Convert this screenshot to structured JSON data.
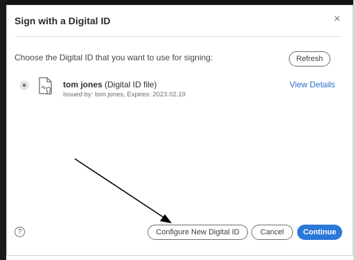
{
  "dialog": {
    "title": "Sign with a Digital ID",
    "close_icon": "×",
    "prompt": "Choose the Digital ID that you want to use for signing:",
    "refresh_label": "Refresh"
  },
  "digital_id": {
    "name": "tom jones",
    "type": " (Digital ID file)",
    "issued": "Issued by: tom jones, Expires: 2023.02.19",
    "view_details_label": "View Details",
    "selected": true,
    "icon": "certificate-file-icon"
  },
  "footer": {
    "help_icon": "?",
    "configure_label": "Configure New Digital ID",
    "cancel_label": "Cancel",
    "continue_label": "Continue"
  },
  "colors": {
    "accent": "#2b78d9",
    "link": "#2d6fc9"
  }
}
